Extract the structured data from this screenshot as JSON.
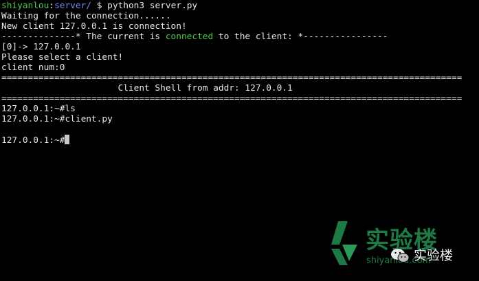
{
  "prompt": {
    "user_host": "shiyanlou",
    "path": "server/",
    "symbol": "$",
    "command": "python3 server.py"
  },
  "lines": {
    "waiting": "Waiting for the connection......",
    "new_client": "New client 127.0.0.1 is connection!",
    "status_prefix": "--------------* The current is ",
    "status_keyword": "connected",
    "status_suffix": " to the client: *----------------",
    "client_entry": "[0]-> 127.0.0.1",
    "select_prompt": "Please select a client!",
    "client_num": "client num:0",
    "separator_top": "=======================================================================================",
    "shell_header": "                      Client Shell from addr: 127.0.0.1",
    "separator_bottom": "=======================================================================================",
    "cmd_ls": "127.0.0.1:~#ls",
    "cmd_client": "127.0.0.1:~#client.py",
    "current_prompt": "127.0.0.1:~#"
  },
  "watermark": {
    "brand_cn": "实验楼",
    "url": "shiyanlou.com",
    "wechat_label": "实验楼"
  },
  "colors": {
    "background": "#000000",
    "text": "#e8e8e8",
    "green": "#4ec94e",
    "blue": "#6f8cf2",
    "watermark": "#1e7a45"
  }
}
